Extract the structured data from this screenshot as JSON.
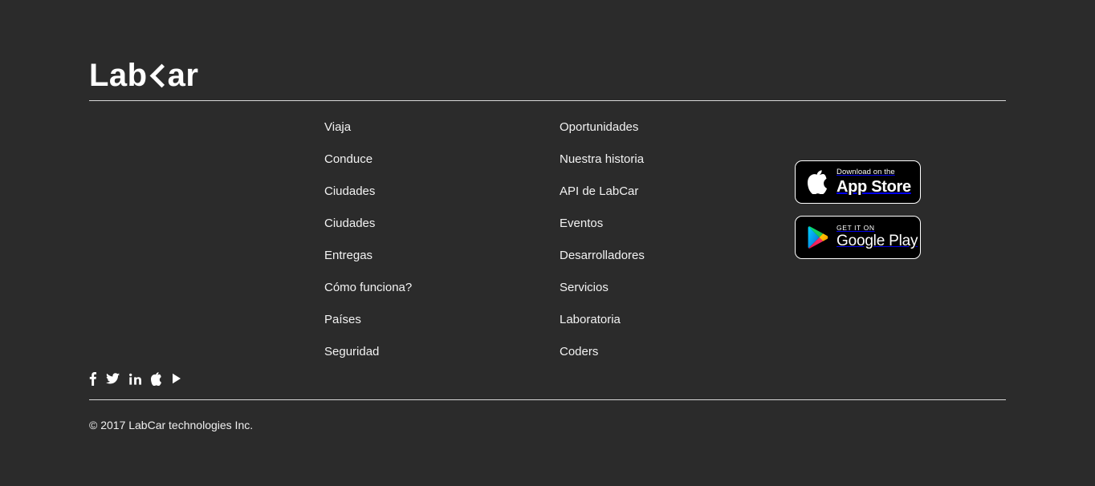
{
  "colors": {
    "background": "#2b2b2b",
    "text": "#f2f2f2",
    "divider": "#d8d8d8",
    "badge_bg": "#000000",
    "badge_border": "#ffffff"
  },
  "logo": {
    "part1": "Lab",
    "chevron_icon": "chevron-left-icon",
    "part2": "ar",
    "full_text": "LabCar"
  },
  "link_columns": [
    {
      "items": [
        {
          "label": "Viaja"
        },
        {
          "label": "Conduce"
        },
        {
          "label": "Ciudades"
        },
        {
          "label": "Ciudades"
        },
        {
          "label": "Entregas"
        },
        {
          "label": "Cómo funciona?"
        },
        {
          "label": "Países"
        },
        {
          "label": "Seguridad"
        }
      ]
    },
    {
      "items": [
        {
          "label": "Oportunidades"
        },
        {
          "label": "Nuestra historia"
        },
        {
          "label": "API de LabCar"
        },
        {
          "label": "Eventos"
        },
        {
          "label": "Desarrolladores"
        },
        {
          "label": "Servicios"
        },
        {
          "label": "Laboratoria"
        },
        {
          "label": "Coders"
        }
      ]
    }
  ],
  "badges": {
    "app_store": {
      "icon": "apple-logo-icon",
      "top_line": "Download on the",
      "bottom_line": "App Store"
    },
    "google_play": {
      "icon": "google-play-icon",
      "top_line": "GET IT ON",
      "bottom_line": "Google Play"
    }
  },
  "social": [
    {
      "icon": "facebook-icon",
      "name": "Facebook"
    },
    {
      "icon": "twitter-icon",
      "name": "Twitter"
    },
    {
      "icon": "linkedin-icon",
      "name": "LinkedIn"
    },
    {
      "icon": "apple-icon",
      "name": "Apple"
    },
    {
      "icon": "play-icon",
      "name": "Play"
    }
  ],
  "copyright": "© 2017 LabCar technologies Inc."
}
